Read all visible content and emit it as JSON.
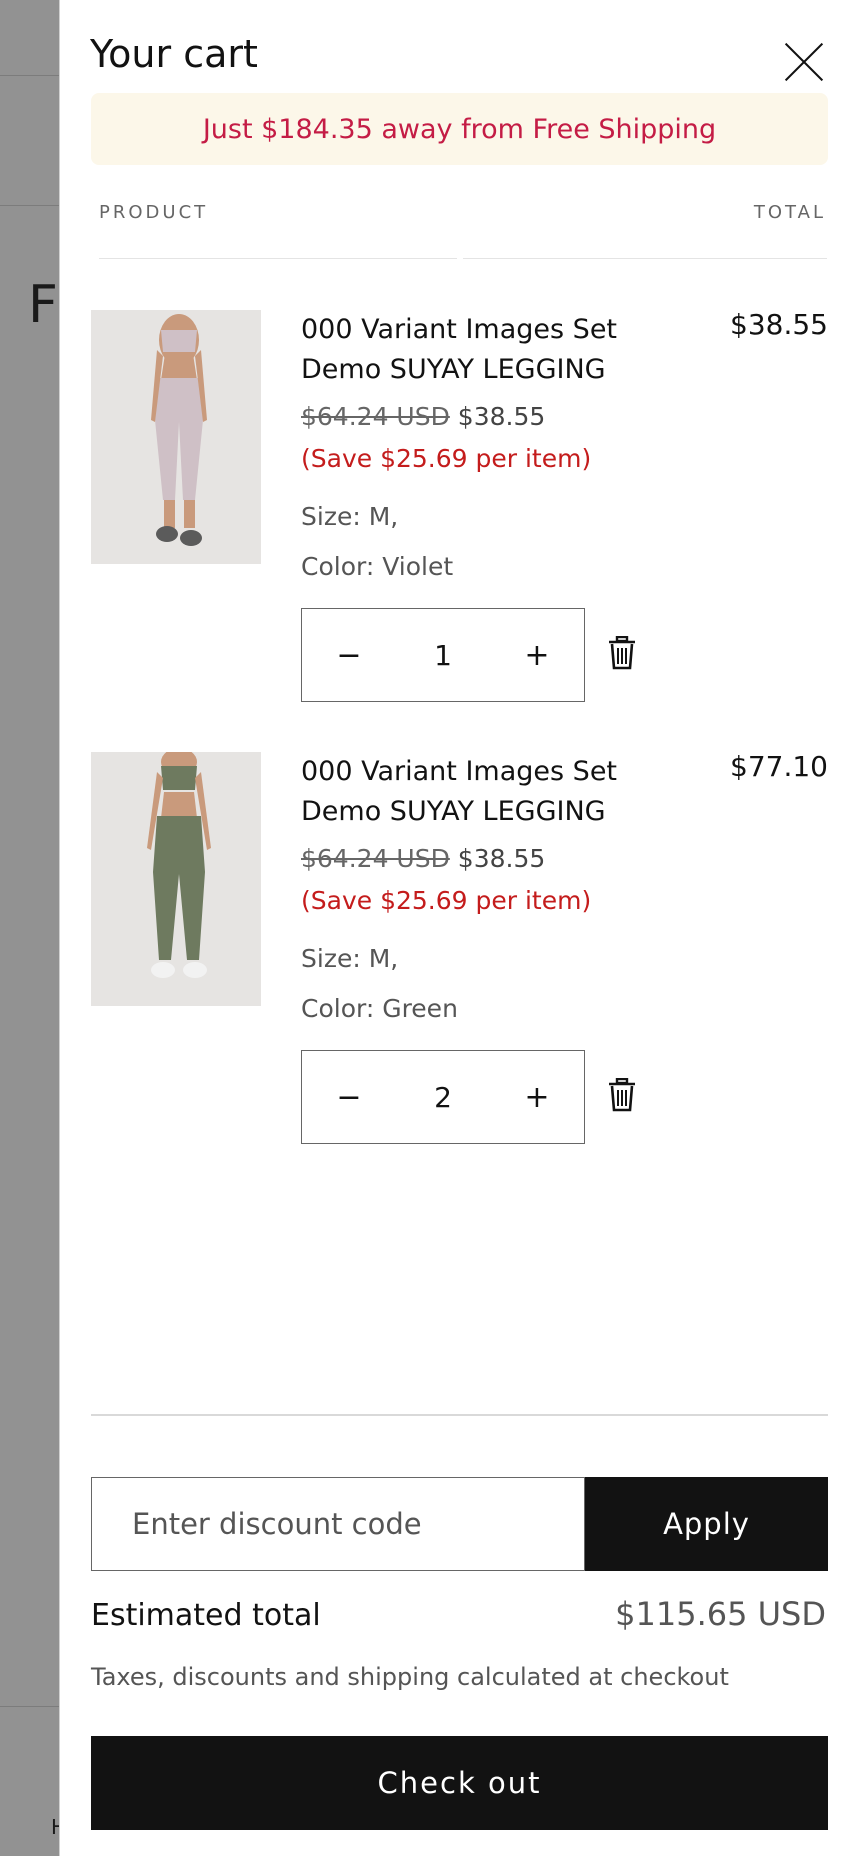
{
  "background": {
    "letter": "F",
    "footer_letter": "H"
  },
  "cart": {
    "title": "Your cart",
    "shipping_banner": "Just $184.35 away from Free Shipping",
    "columns": {
      "product": "PRODUCT",
      "total": "TOTAL"
    },
    "items": [
      {
        "name": "000 Variant Images Set Demo SUYAY LEGGING",
        "total": "$38.55",
        "compare_price": "$64.24 USD",
        "price": "$38.55",
        "savings": "(Save $25.69 per item)",
        "size": "Size: M,",
        "color": "Color: Violet",
        "quantity": "1",
        "color_swatch": "#cfc0c6",
        "image_icon": "violet-legging-photo"
      },
      {
        "name": "000 Variant Images Set Demo SUYAY LEGGING",
        "total": "$77.10",
        "compare_price": "$64.24 USD",
        "price": "$38.55",
        "savings": "(Save $25.69 per item)",
        "size": "Size: M,",
        "color": "Color: Green",
        "quantity": "2",
        "color_swatch": "#6e7a5f",
        "image_icon": "green-legging-photo"
      }
    ],
    "discount": {
      "placeholder": "Enter discount code",
      "apply_label": "Apply"
    },
    "estimated_total_label": "Estimated total",
    "estimated_total_value": "$115.65 USD",
    "tax_note": "Taxes, discounts and shipping calculated at checkout",
    "checkout_label": "Check out"
  },
  "colors": {
    "accent_red": "#c41c45",
    "save_red": "#c41c1c",
    "banner_bg": "#fcf7e9",
    "button_dark": "#121212"
  }
}
